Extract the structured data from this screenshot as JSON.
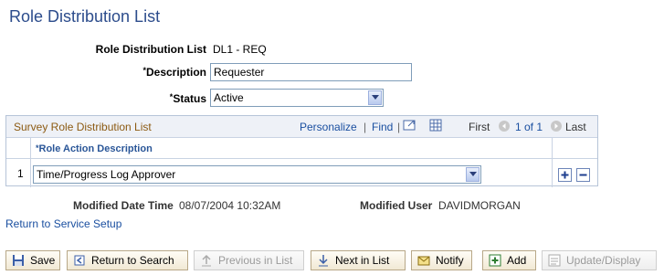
{
  "page": {
    "title": "Role Distribution List"
  },
  "form": {
    "rdl_label": "Role Distribution List",
    "rdl_value": "DL1 - REQ",
    "description_label": "Description",
    "description_value": "Requester",
    "status_label": "Status",
    "status_value": "Active",
    "required_mark": "*"
  },
  "grid": {
    "title": "Survey Role Distribution List",
    "personalize": "Personalize",
    "sep": "|",
    "find": "Find",
    "first": "First",
    "range": "1 of 1",
    "last": "Last",
    "column_header": "Role Action Description",
    "rows": [
      {
        "num": "1",
        "value": "Time/Progress Log Approver"
      }
    ]
  },
  "modified": {
    "date_label": "Modified Date Time",
    "date_value": "08/07/2004 10:32AM",
    "user_label": "Modified User",
    "user_value": "DAVIDMORGAN"
  },
  "links": {
    "return_setup": "Return to Service Setup"
  },
  "toolbar": {
    "save": "Save",
    "return_search": "Return to Search",
    "prev_list": "Previous in List",
    "next_list": "Next in List",
    "notify": "Notify",
    "add": "Add",
    "update_display": "Update/Display"
  },
  "colors": {
    "title": "#2c4c8c",
    "link": "#1a4fa0",
    "grid_title": "#8c5a12"
  }
}
